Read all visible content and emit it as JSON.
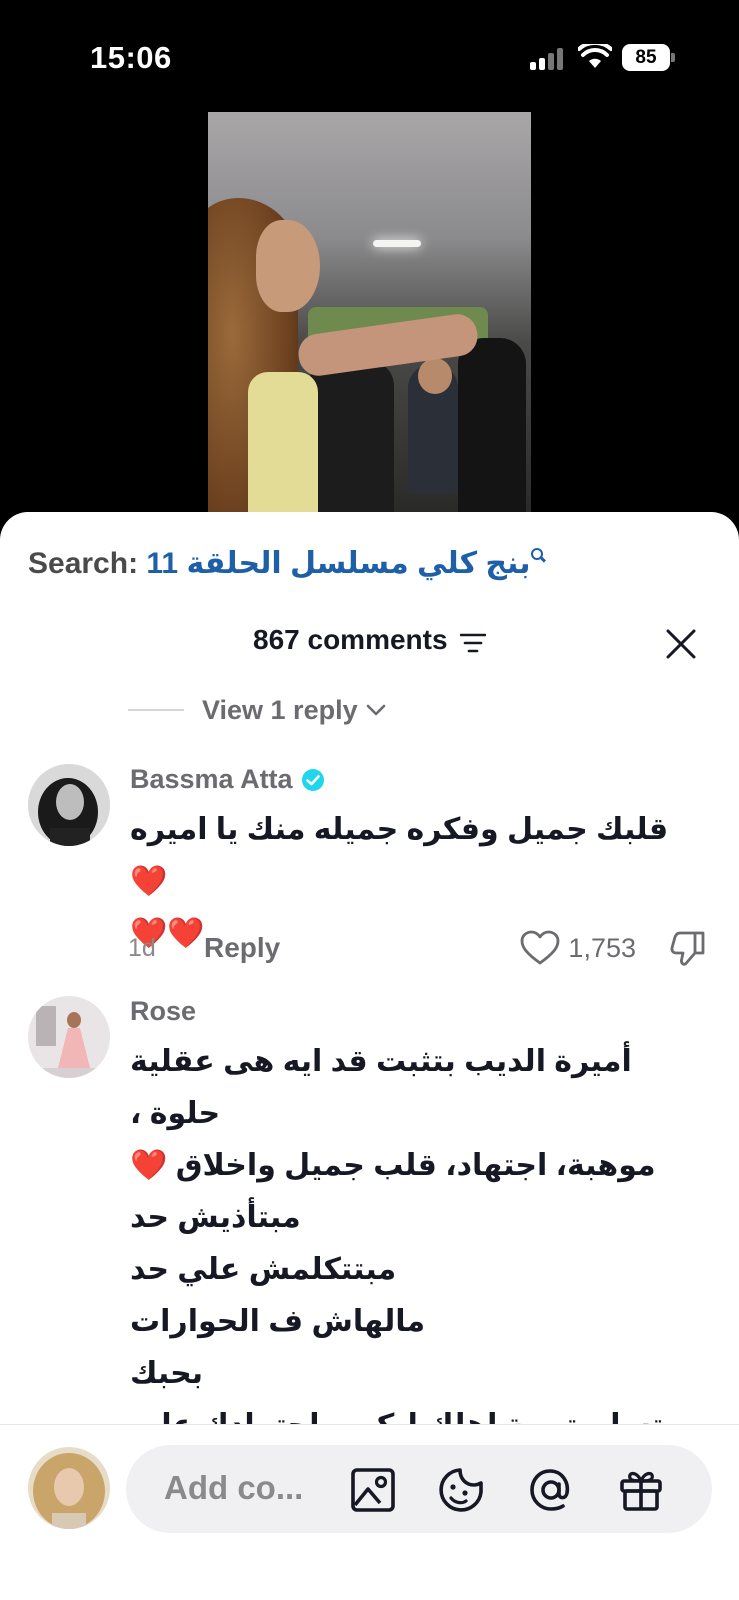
{
  "status_bar": {
    "time": "15:06",
    "battery": "85"
  },
  "search": {
    "label": "Search:",
    "query": "بنج كلي مسلسل الحلقة 11"
  },
  "comments_header": {
    "count_label": "867 comments"
  },
  "view_reply": {
    "label": "View 1 reply"
  },
  "comments": [
    {
      "username": "Bassma Atta",
      "verified": true,
      "lines": [
        "قلبك جميل وفكره جميله منك يا اميره ❤️",
        "❤️❤️"
      ],
      "time": "1d",
      "reply_label": "Reply",
      "likes": "1,753"
    },
    {
      "username": "Rose",
      "verified": false,
      "lines": [
        "أميرة الديب بتثبت قد ايه هى عقلية حلوة ،",
        "موهبة، اجتهاد، قلب جميل واخلاق ❤️",
        "مبتأذيش حد",
        "مبتتكلمش علي حد",
        "مالهاش ف الحوارات",
        "بحبك",
        "وتسلم تربية اهلك ليكى واجتهادك علي"
      ]
    }
  ],
  "input": {
    "placeholder": "Add co..."
  },
  "colors": {
    "accent_blue": "#1f5fa8",
    "verified": "#20d5ec",
    "heart": "#e01e2c"
  }
}
